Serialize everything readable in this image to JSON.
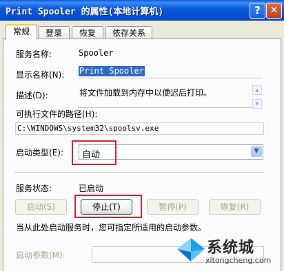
{
  "window": {
    "title": "Print Spooler 的属性(本地计算机)",
    "help_glyph": "?",
    "close_glyph": "✕"
  },
  "tabs": [
    "常规",
    "登录",
    "恢复",
    "依存关系"
  ],
  "general": {
    "service_name_label": "服务名称:",
    "service_name": "Spooler",
    "display_name_label": "显示名称(N):",
    "display_name": "Print Spooler",
    "description_label": "描述(D):",
    "description": "将文件加载到内存中以便迟后打印。",
    "exe_path_label": "可执行文件的路径(H):",
    "exe_path": "C:\\WINDOWS\\system32\\spoolsv.exe",
    "startup_type_label": "启动类型(E):",
    "startup_type": "自动",
    "status_label": "服务状态:",
    "status": "已启动",
    "buttons": {
      "start": "启动(S)",
      "stop": "停止(T)",
      "pause": "暂停(P)",
      "resume": "恢复(R)"
    },
    "hint": "当从此处启动服务时，您可指定所适用的启动参数。",
    "params_label": "启动参数(M):",
    "params_value": ""
  },
  "watermark": {
    "text_cn": "系统城",
    "text_en": "xitongcheng.com"
  },
  "colors": {
    "highlight_box": "#d9232a",
    "titlebar": "#0a5ae0",
    "selection": "#316ac5"
  }
}
